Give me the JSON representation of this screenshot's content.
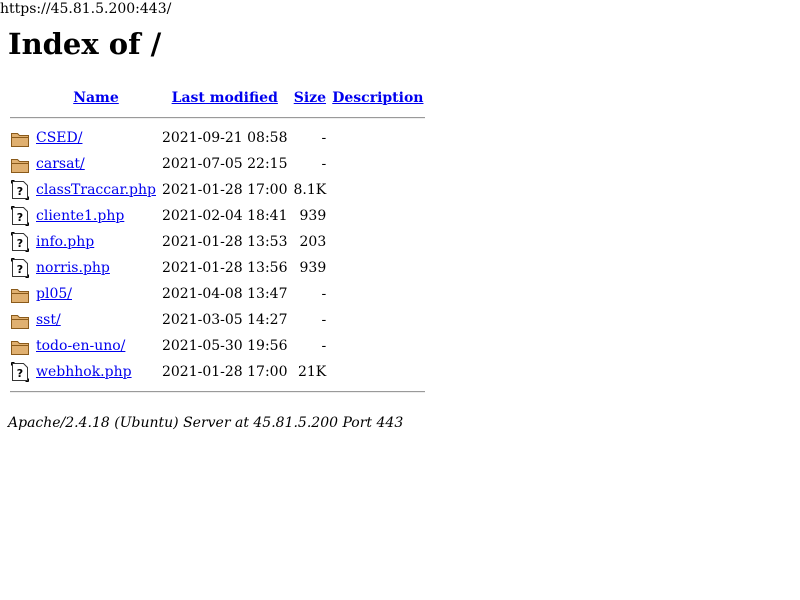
{
  "url": "https://45.81.5.200:443/",
  "title": "Index of /",
  "headers": {
    "name": "Name",
    "last_modified": "Last modified",
    "size": "Size",
    "description": "Description"
  },
  "rows": [
    {
      "icon": "folder-icon",
      "name": "CSED/",
      "modified": "2021-09-21 08:58",
      "size": "-",
      "description": ""
    },
    {
      "icon": "folder-icon",
      "name": "carsat/",
      "modified": "2021-07-05 22:15",
      "size": "-",
      "description": ""
    },
    {
      "icon": "unknown-file-icon",
      "name": "classTraccar.php",
      "modified": "2021-01-28 17:00",
      "size": "8.1K",
      "description": ""
    },
    {
      "icon": "unknown-file-icon",
      "name": "cliente1.php",
      "modified": "2021-02-04 18:41",
      "size": "939",
      "description": ""
    },
    {
      "icon": "unknown-file-icon",
      "name": "info.php",
      "modified": "2021-01-28 13:53",
      "size": "203",
      "description": ""
    },
    {
      "icon": "unknown-file-icon",
      "name": "norris.php",
      "modified": "2021-01-28 13:56",
      "size": "939",
      "description": ""
    },
    {
      "icon": "folder-icon",
      "name": "pl05/",
      "modified": "2021-04-08 13:47",
      "size": "-",
      "description": ""
    },
    {
      "icon": "folder-icon",
      "name": "sst/",
      "modified": "2021-03-05 14:27",
      "size": "-",
      "description": ""
    },
    {
      "icon": "folder-icon",
      "name": "todo-en-uno/",
      "modified": "2021-05-30 19:56",
      "size": "-",
      "description": ""
    },
    {
      "icon": "unknown-file-icon",
      "name": "webhhok.php",
      "modified": "2021-01-28 17:00",
      "size": "21K",
      "description": ""
    }
  ],
  "footer": "Apache/2.4.18 (Ubuntu) Server at 45.81.5.200 Port 443",
  "colors": {
    "link": "#0000ee",
    "folder_fill": "#e0b070",
    "folder_stroke": "#8a5a1a",
    "file_stroke": "#333333"
  }
}
